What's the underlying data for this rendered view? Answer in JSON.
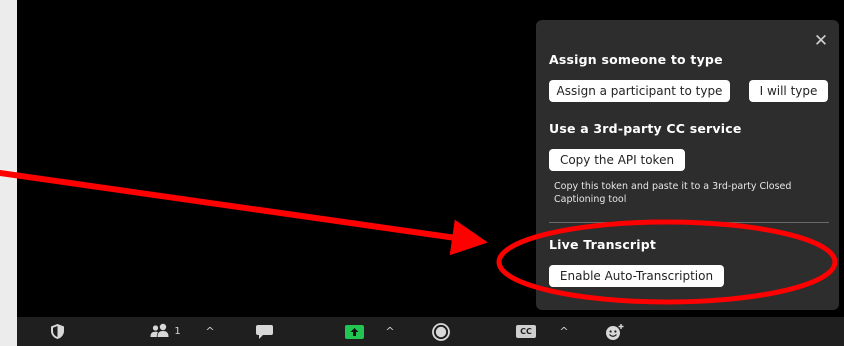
{
  "cc_panel": {
    "close_glyph": "✕",
    "assign_heading": "Assign someone to type",
    "assign_participant_button": "Assign a participant to type",
    "i_will_type_button": "I will type",
    "third_party_heading": "Use a 3rd-party CC service",
    "copy_token_button": "Copy the API token",
    "token_description": "Copy this token and paste it to a 3rd-party Closed Captioning tool",
    "live_transcript_heading": "Live Transcript",
    "enable_transcription_button": "Enable Auto-Transcription"
  },
  "toolbar": {
    "participants_count": "1",
    "chevron_glyph": "^",
    "cc_label": "CC",
    "share_accent": "#23c552"
  },
  "annotation": {
    "color": "#ff0000"
  }
}
